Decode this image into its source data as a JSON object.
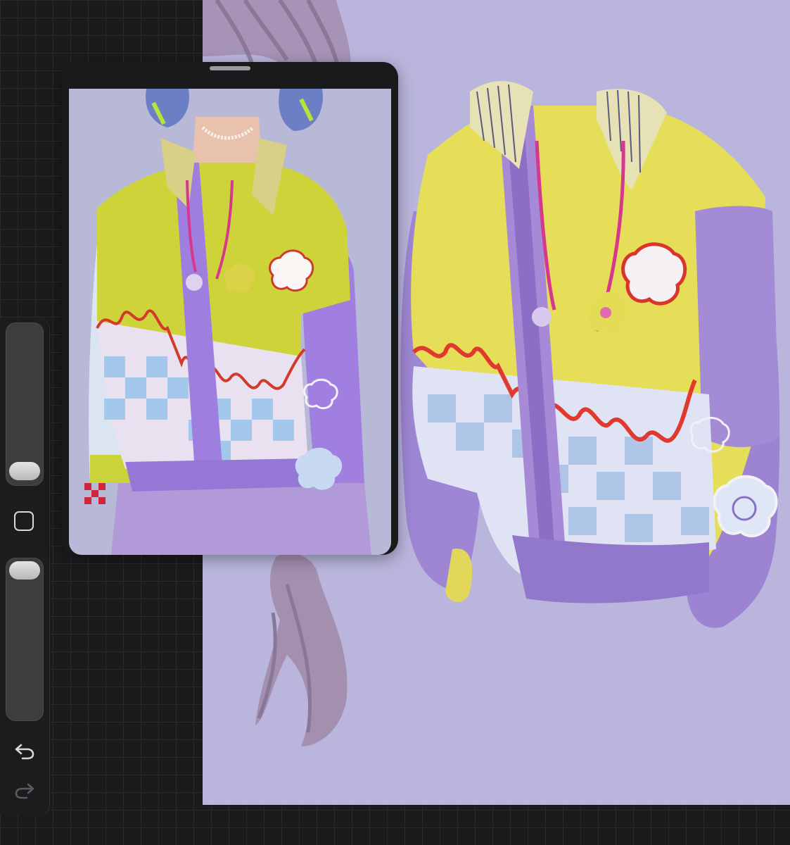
{
  "app": {
    "canvas_color": "#b9b5dc",
    "ui_color": "#1c1c1e",
    "accent_yellow": "#e6dd55",
    "accent_purple": "#a98ae0"
  },
  "sidebar": {
    "brush_size_level": 0.85,
    "opacity_level": 0.02,
    "icons": [
      "modify-square-icon",
      "undo-icon",
      "redo-icon"
    ]
  },
  "reference_window": {
    "icons": [
      "drag-handle-icon"
    ]
  }
}
